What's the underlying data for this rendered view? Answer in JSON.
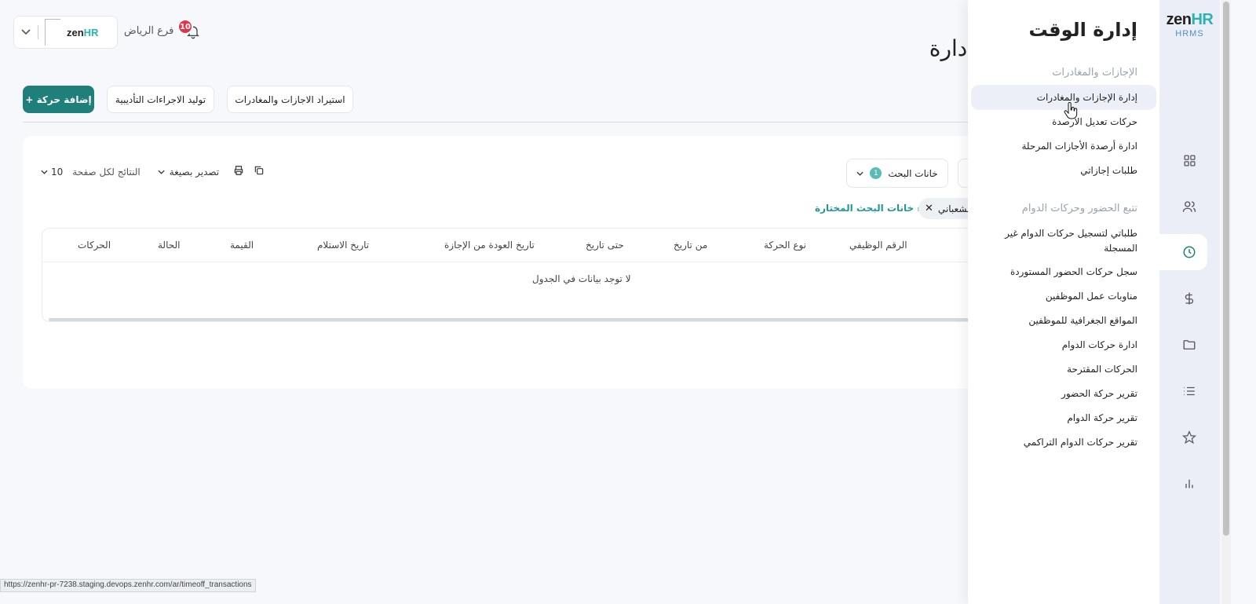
{
  "header": {
    "branch": "فرع الرياض",
    "notifications_count": "10",
    "logo_text": "zen",
    "logo_suffix": "HR"
  },
  "page": {
    "title": "إدارة الإجازات والمغادرات",
    "buttons": {
      "add": "+ إضافة حركة",
      "disciplinary": "توليد الاجراءات التأديبية",
      "import": "استيراد الاجازات والمغادرات"
    },
    "toolbar": {
      "per_page_label": "النتائج لكل صفحة",
      "per_page_value": "10",
      "export_label": "تصدير بصيغة"
    },
    "search_fields": {
      "label": "خانات البحث",
      "count": "1"
    },
    "clear_filters": "إلغاء خانات البحث المختارة",
    "chip_text": "الشعباني",
    "table": {
      "columns": [
        "الرقم الوظيفي",
        "نوع الحركة",
        "من تاريخ",
        "حتى تاريخ",
        "تاريخ العودة من الإجازة",
        "تاريخ الاستلام",
        "القيمة",
        "الحالة",
        "الحركات"
      ],
      "empty": "لا توجد بيانات في الجدول"
    }
  },
  "status_url": "https://zenhr-pr-7238.staging.devops.zenhr.com/ar/timeoff_transactions",
  "flyout": {
    "title": "إدارة الوقت",
    "sections": [
      {
        "title": "الإجازات والمغادرات",
        "items": [
          "إدارة الإجازات والمغادرات",
          "حركات تعديل الأرصدة",
          "ادارة أرصدة الأجازات المرحلة",
          "طلبات إجازاتي"
        ]
      },
      {
        "title": "تتبع الحضور وحركات الدوام",
        "items": [
          "طلباتي لتسجيل حركات الدوام غير المسجلة",
          "سجل حركات الحضور المستوردة",
          "مناوبات عمل الموظفين",
          "المواقع الجغرافية للموظفين",
          "ادارة حركات الدوام",
          "الحركات المقترحة",
          "تقرير حركة الحضور",
          "تقرير حركة الدوام",
          "تقرير حركات الدوام التراكمي"
        ]
      }
    ]
  },
  "rail": {
    "brand_zen": "zen",
    "brand_hr": "HR",
    "brand_sub": "HRMS",
    "icons": [
      "grid-icon",
      "users-icon",
      "clock-icon",
      "dollar-icon",
      "folder-icon",
      "list-icon",
      "star-icon",
      "chart-icon"
    ],
    "active": "clock-icon"
  },
  "colors": {
    "primary": "#1f7f7a",
    "accent": "#27b5b2",
    "badge": "#e0334c"
  }
}
